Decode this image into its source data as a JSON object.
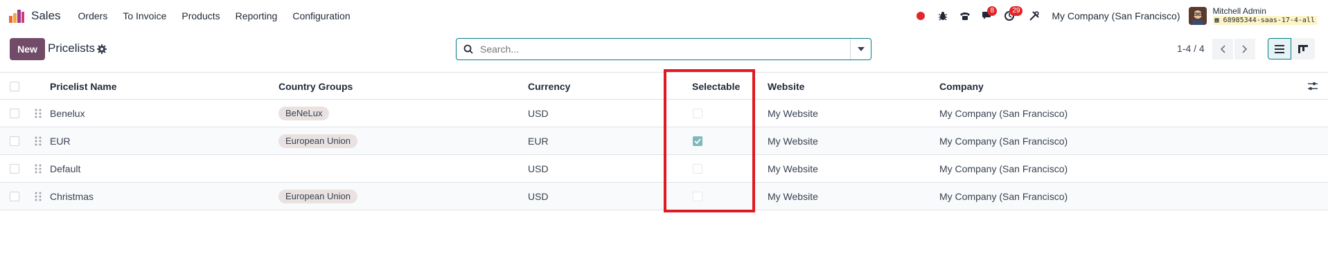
{
  "navbar": {
    "app_name": "Sales",
    "menu": [
      "Orders",
      "To Invoice",
      "Products",
      "Reporting",
      "Configuration"
    ],
    "icons": [
      "record-icon",
      "bug-icon",
      "phone-icon",
      "chat-icon",
      "activity-icon",
      "tools-icon"
    ],
    "messages_count": "8",
    "activities_count": "29",
    "company": "My Company (San Francisco)",
    "user_name": "Mitchell Admin",
    "database": "68985344-saas-17-4-all"
  },
  "control": {
    "new_label": "New",
    "title": "Pricelists",
    "search_placeholder": "Search...",
    "pager": "1-4 / 4"
  },
  "table": {
    "columns": [
      "Pricelist Name",
      "Country Groups",
      "Currency",
      "Selectable",
      "Website",
      "Company"
    ],
    "rows": [
      {
        "name": "Benelux",
        "country_group": "BeNeLux",
        "currency": "USD",
        "selectable": false,
        "website": "My Website",
        "company": "My Company (San Francisco)"
      },
      {
        "name": "EUR",
        "country_group": "European Union",
        "currency": "EUR",
        "selectable": true,
        "website": "My Website",
        "company": "My Company (San Francisco)"
      },
      {
        "name": "Default",
        "country_group": "",
        "currency": "USD",
        "selectable": false,
        "website": "My Website",
        "company": "My Company (San Francisco)"
      },
      {
        "name": "Christmas",
        "country_group": "European Union",
        "currency": "USD",
        "selectable": false,
        "website": "My Website",
        "company": "My Company (San Francisco)"
      }
    ]
  },
  "colors": {
    "primary": "#714B67",
    "accent": "#017e84",
    "badge": "#e0262b",
    "highlight": "#e01a22",
    "checked": "#7eb9bc"
  }
}
